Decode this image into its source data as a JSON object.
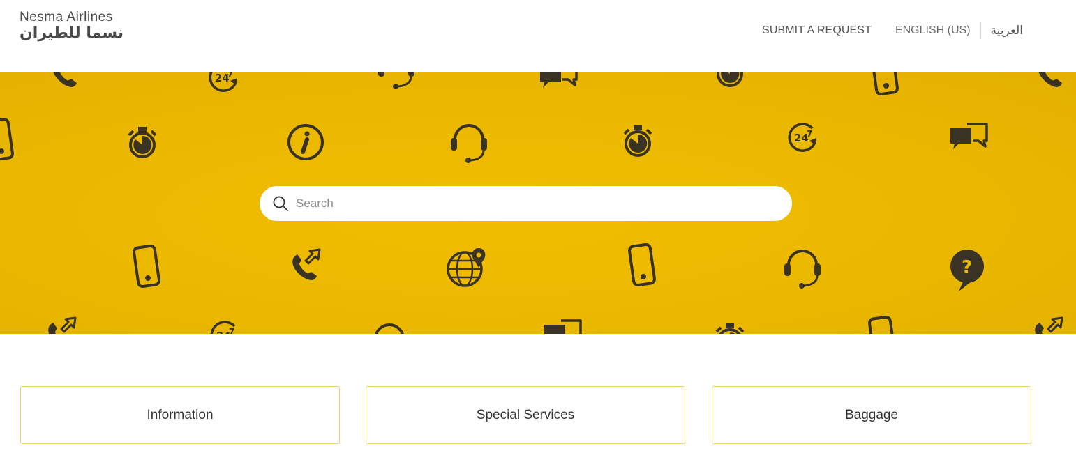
{
  "brand": {
    "name_en": "Nesma Airlines",
    "name_ar": "نسما للطيران"
  },
  "nav": {
    "submit_request": "SUBMIT A REQUEST",
    "current_language": "ENGLISH (US)",
    "alt_language": "العربية"
  },
  "search": {
    "placeholder": "Search",
    "value": ""
  },
  "categories": [
    {
      "label": "Information"
    },
    {
      "label": "Special Services"
    },
    {
      "label": "Baggage"
    }
  ],
  "colors": {
    "hero_background": "#ecb900",
    "icon_dark": "#3a3324",
    "card_border": "#f0d267"
  },
  "hero_icons": [
    "phone-icon",
    "clock-247-icon",
    "headset-icon",
    "chat-icon",
    "stopwatch-icon",
    "mobile-icon",
    "info-icon",
    "globe-pin-icon",
    "question-bubble-icon",
    "phone-outgoing-icon"
  ]
}
